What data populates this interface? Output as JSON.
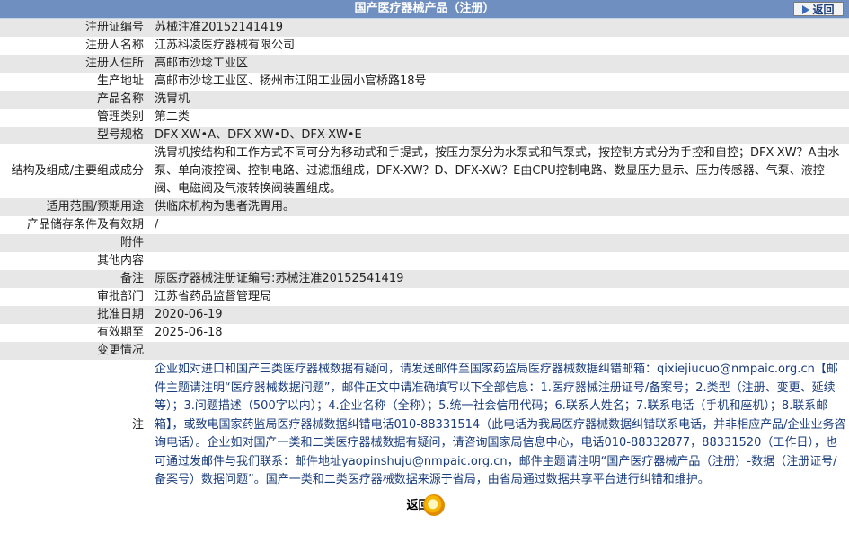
{
  "header": {
    "title": "国产医疗器械产品（注册）",
    "back_label": "返回"
  },
  "rows": [
    {
      "label": "注册证编号",
      "value": "苏械注准20152141419"
    },
    {
      "label": "注册人名称",
      "value": "江苏科凌医疗器械有限公司"
    },
    {
      "label": "注册人住所",
      "value": "高邮市沙埝工业区"
    },
    {
      "label": "生产地址",
      "value": "高邮市沙埝工业区、扬州市江阳工业园小官桥路18号"
    },
    {
      "label": "产品名称",
      "value": "洗胃机"
    },
    {
      "label": "管理类别",
      "value": "第二类"
    },
    {
      "label": "型号规格",
      "value": "DFX-XW•A、DFX-XW•D、DFX-XW•E"
    },
    {
      "label": "结构及组成/主要组成成分",
      "value": "洗胃机按结构和工作方式不同可分为移动式和手提式，按压力泵分为水泵式和气泵式，按控制方式分为手控和自控；DFX-XW？A由水泵、单向液控阀、控制电路、过滤瓶组成，DFX-XW？D、DFX-XW？E由CPU控制电路、数显压力显示、压力传感器、气泵、液控阀、电磁阀及气液转换阀装置组成。"
    },
    {
      "label": "适用范围/预期用途",
      "value": "供临床机构为患者洗胃用。"
    },
    {
      "label": "产品储存条件及有效期",
      "value": "/"
    },
    {
      "label": "附件",
      "value": ""
    },
    {
      "label": "其他内容",
      "value": ""
    },
    {
      "label": "备注",
      "value": "原医疗器械注册证编号:苏械注准20152541419"
    },
    {
      "label": "审批部门",
      "value": "江苏省药品监督管理局"
    },
    {
      "label": "批准日期",
      "value": "2020-06-19"
    },
    {
      "label": "有效期至",
      "value": "2025-06-18"
    },
    {
      "label": "变更情况",
      "value": ""
    }
  ],
  "notice": {
    "label": "注",
    "text": "企业如对进口和国产三类医疗器械数据有疑问，请发送邮件至国家药监局医疗器械数据纠错邮箱：qixiejiucuo@nmpaic.org.cn【邮件主题请注明“医疗器械数据问题”，邮件正文中请准确填写以下全部信息：1.医疗器械注册证号/备案号；2.类型（注册、变更、延续等）；3.问题描述（500字以内）；4.企业名称（全称）；5.统一社会信用代码；6.联系人姓名；7.联系电话（手机和座机）；8.联系邮箱】，或致电国家药监局医疗器械数据纠错电话010-88331514（此电话为我局医疗器械数据纠错联系电话，并非相应产品/企业业务咨询电话）。企业如对国产一类和二类医疗器械数据有疑问，请咨询国家局信息中心，电话010-88332877，88331520（工作日），也可通过发邮件与我们联系：邮件地址yaopinshuju@nmpaic.org.cn，邮件主题请注明“国产医疗器械产品（注册）-数据（注册证号/备案号）数据问题”。国产一类和二类医疗器械数据来源于省局，由省局通过数据共享平台进行纠错和维护。"
  },
  "footer": {
    "back_label": "返回"
  }
}
